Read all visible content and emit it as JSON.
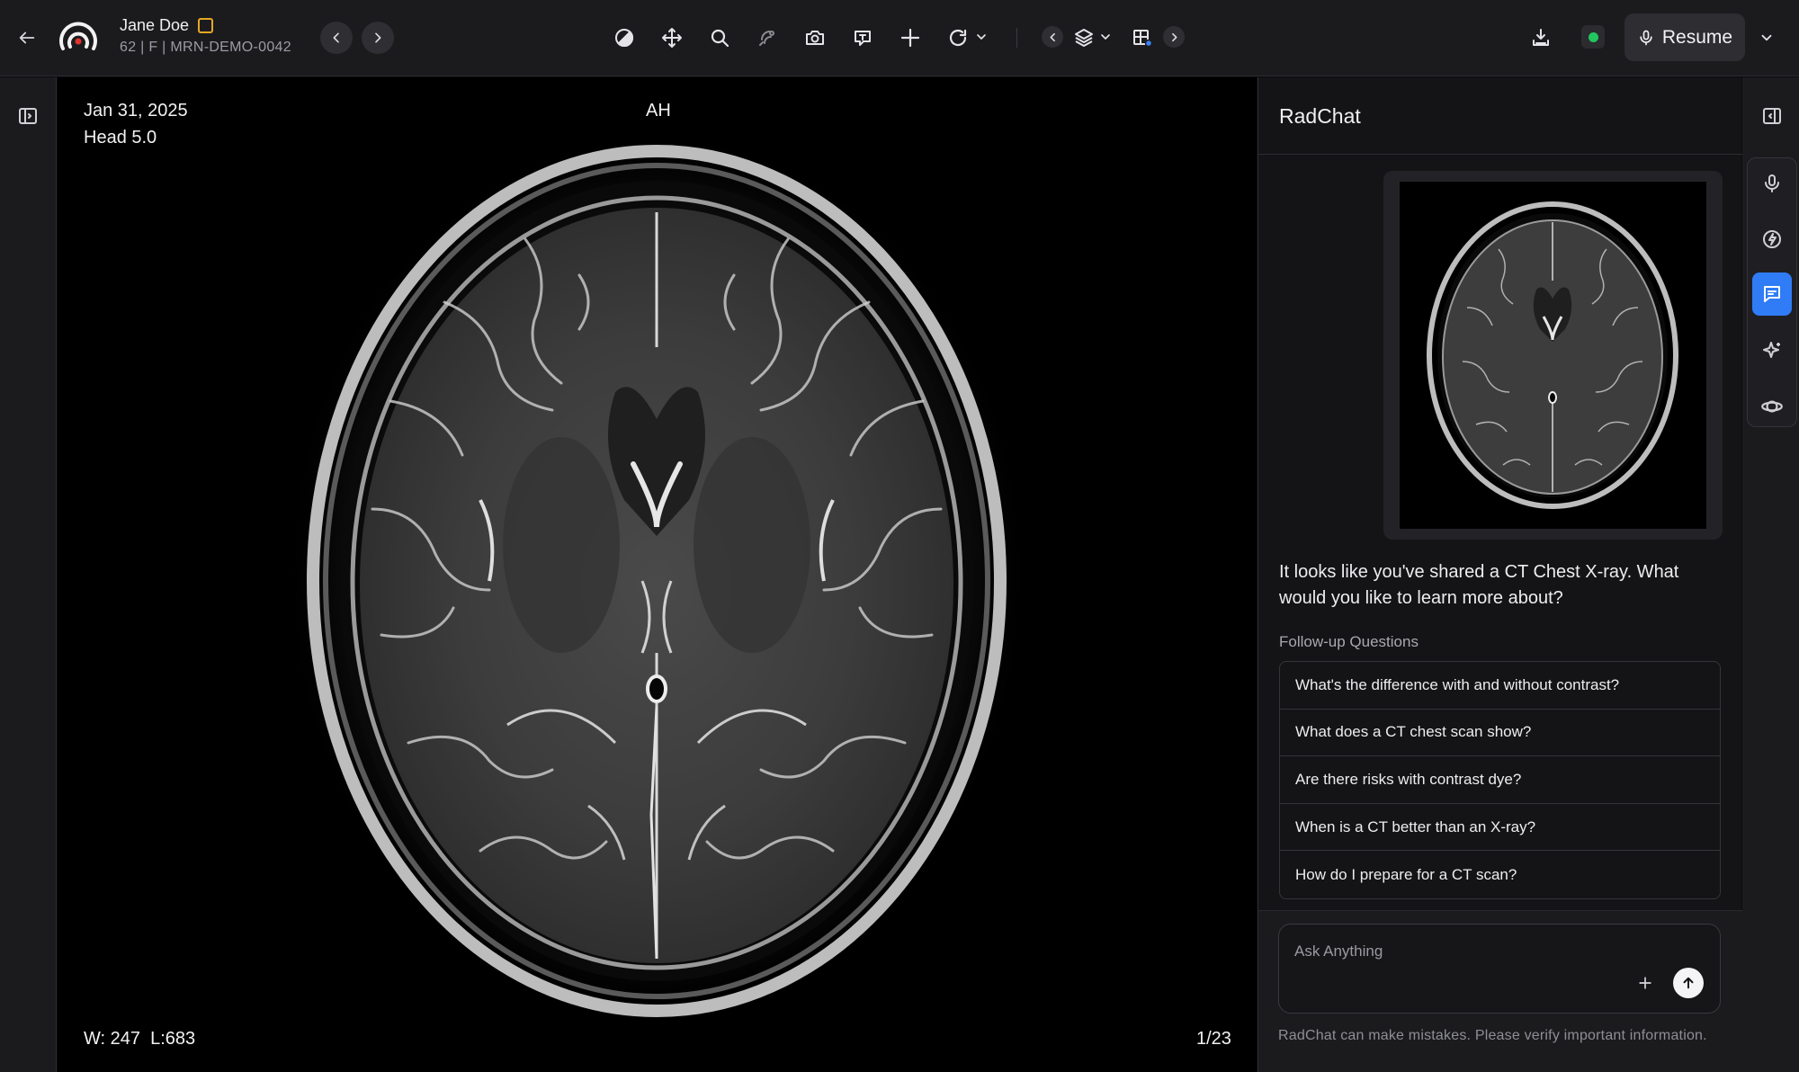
{
  "app": {
    "brand_icon": "radar-logo-icon"
  },
  "patient": {
    "name": "Jane Doe",
    "meta": "62 | F | MRN-DEMO-0042",
    "flag_color": "#e5a823"
  },
  "toolbar": {
    "tools": [
      "contrast-icon",
      "pan-icon",
      "zoom-icon",
      "segment-icon",
      "camera-icon",
      "annotate-icon",
      "crosshair-icon",
      "rotate-icon",
      "layers-icon",
      "layout-icon"
    ],
    "status_color": "#22c55e",
    "resume_label": "Resume"
  },
  "viewer": {
    "date": "Jan 31, 2025",
    "series": "Head 5.0",
    "orientation": "AH",
    "window_level": "W: 247  L:683",
    "slice": "1/23"
  },
  "chat": {
    "title": "RadChat",
    "message": "It looks like you've shared a CT Chest X-ray. What would you like to learn more about?",
    "followup_label": "Follow-up Questions",
    "followups": [
      "What's the difference with and without contrast?",
      "What does a CT chest scan show?",
      "Are there risks with contrast dye?",
      "When is a CT better than an X-ray?",
      "How do I prepare for a CT scan?"
    ],
    "input_placeholder": "Ask Anything",
    "disclaimer": "RadChat can make mistakes. Please verify important information."
  },
  "right_rail": {
    "items": [
      "microphone-icon",
      "clock-bolt-icon",
      "chat-icon",
      "sparkle-icon",
      "orbit-icon"
    ],
    "active": "chat-icon",
    "accent": "#2f7cf6"
  }
}
